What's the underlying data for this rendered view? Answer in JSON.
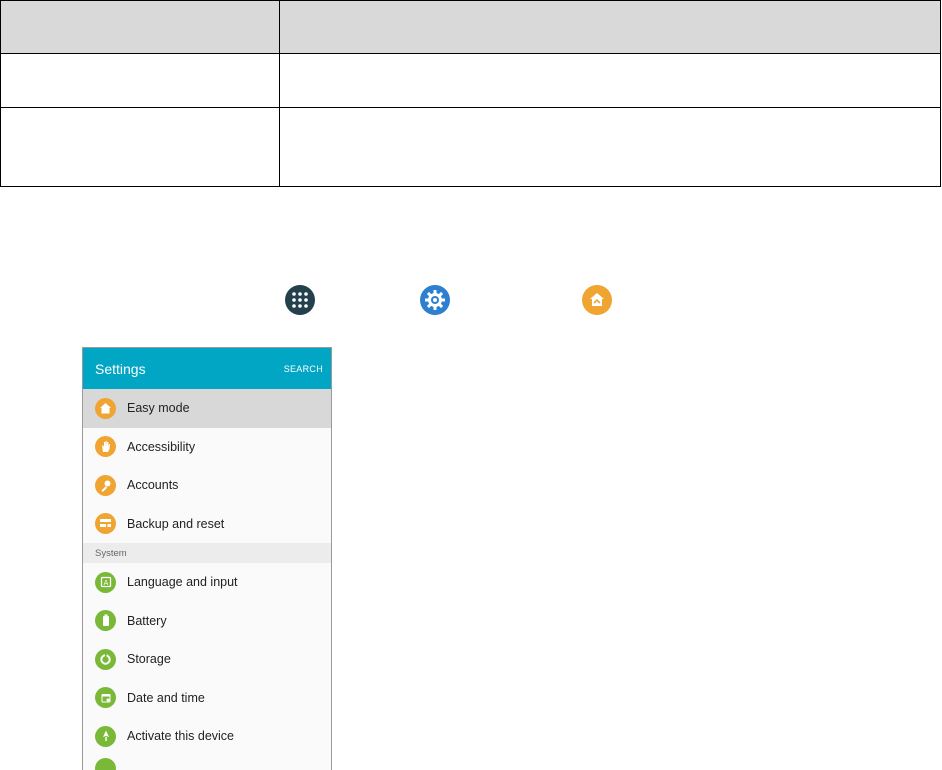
{
  "table": {
    "header": [
      "",
      ""
    ],
    "rows": [
      [
        "",
        ""
      ],
      [
        "",
        ""
      ]
    ]
  },
  "icons": {
    "apps": "apps-icon",
    "settings": "settings-icon",
    "easy_mode": "easy-mode-icon"
  },
  "phone": {
    "title": "Settings",
    "search_label": "SEARCH",
    "header_color": "#00a6c4",
    "items_top": [
      {
        "label": "Easy mode",
        "icon": "easy-mode-icon",
        "selected": true
      },
      {
        "label": "Accessibility",
        "icon": "hand-icon"
      },
      {
        "label": "Accounts",
        "icon": "key-icon"
      },
      {
        "label": "Backup and reset",
        "icon": "backup-icon"
      }
    ],
    "section": "System",
    "items_system": [
      {
        "label": "Language and input",
        "icon": "language-icon"
      },
      {
        "label": "Battery",
        "icon": "battery-icon"
      },
      {
        "label": "Storage",
        "icon": "storage-icon"
      },
      {
        "label": "Date and time",
        "icon": "calendar-icon"
      },
      {
        "label": "Activate this device",
        "icon": "activate-icon"
      }
    ]
  }
}
